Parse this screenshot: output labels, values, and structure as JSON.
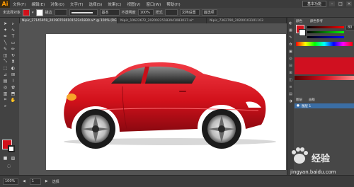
{
  "app": {
    "logo": "Ai"
  },
  "menu": [
    "文件(F)",
    "编辑(E)",
    "对象(O)",
    "文字(T)",
    "选择(S)",
    "效果(C)",
    "视图(V)",
    "窗口(W)",
    "帮助(H)"
  ],
  "workspace": "基本功能",
  "control": {
    "no_selection": "未选择对象",
    "stroke_label": "描边",
    "brush_value": "基本",
    "opacity_label": "不透明度",
    "opacity_value": "100%",
    "style_label": "样式",
    "doc_setup": "文档设置",
    "prefs": "首选项"
  },
  "tabs": [
    "Nipic_27145959_20190703010152341830.ai* @ 100% (RGB/预览)",
    "Nipic_10622672_20200225183941083037.ai*",
    "Nipic_7362790_20200103101103"
  ],
  "panels": {
    "color_tab": "颜色",
    "guide_tab": "颜色参考",
    "color_value": "80",
    "swatches_tab": "色板",
    "layers_tab": "图层",
    "artboards_tab": "画板",
    "layer_name": "图层 1"
  },
  "status": {
    "zoom": "100%",
    "page": "1",
    "mode": "选择"
  },
  "watermark": {
    "text": "经验",
    "sub": "jingyan.baidu.com"
  },
  "colors": {
    "car_red": "#d2111b",
    "panel_red": "#d01020"
  },
  "icons": [
    "select-icon",
    "direct-select-icon",
    "magic-wand-icon",
    "lasso-icon",
    "pen-icon",
    "type-icon",
    "line-icon",
    "rect-icon",
    "brush-icon",
    "pencil-icon",
    "eraser-icon",
    "rotate-icon",
    "scale-icon",
    "width-icon",
    "free-transform-icon",
    "shape-builder-icon",
    "perspective-icon",
    "mesh-icon",
    "gradient-icon",
    "eyedropper-icon",
    "blend-icon",
    "symbol-icon",
    "graph-icon",
    "artboard-icon",
    "slice-icon",
    "hand-icon",
    "zoom-icon"
  ]
}
